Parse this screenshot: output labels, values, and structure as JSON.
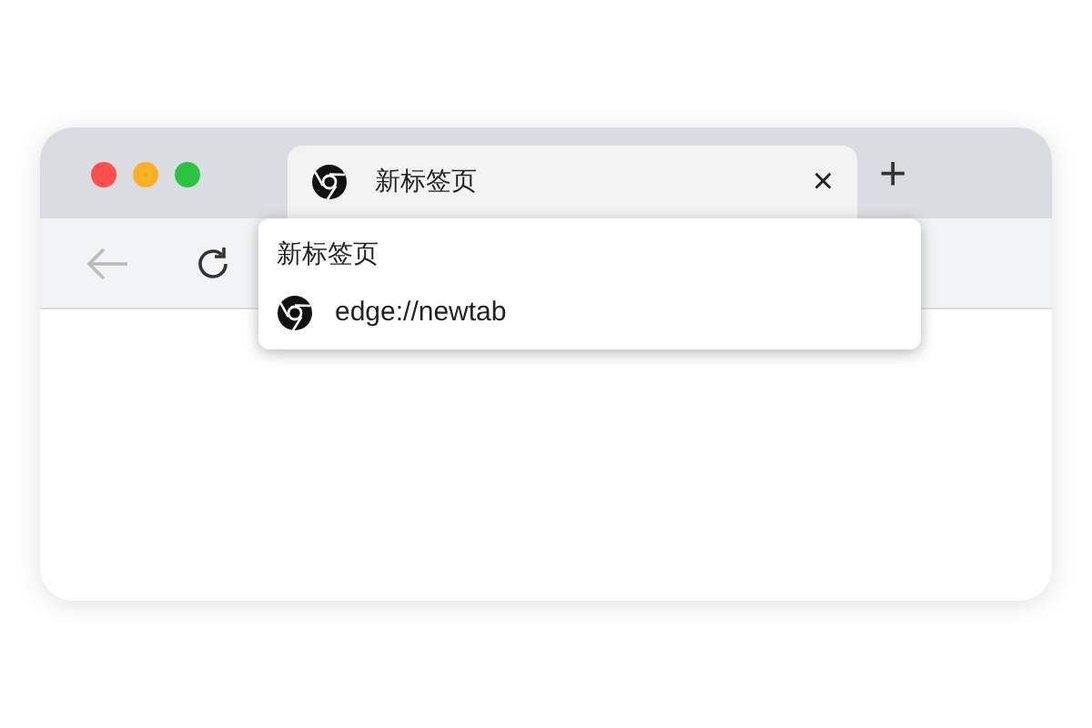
{
  "tab": {
    "title": "新标签页",
    "close": "×",
    "selected": true
  },
  "new_tab": "+",
  "tooltip": {
    "title": "新标签页",
    "url": "edge://newtab"
  }
}
